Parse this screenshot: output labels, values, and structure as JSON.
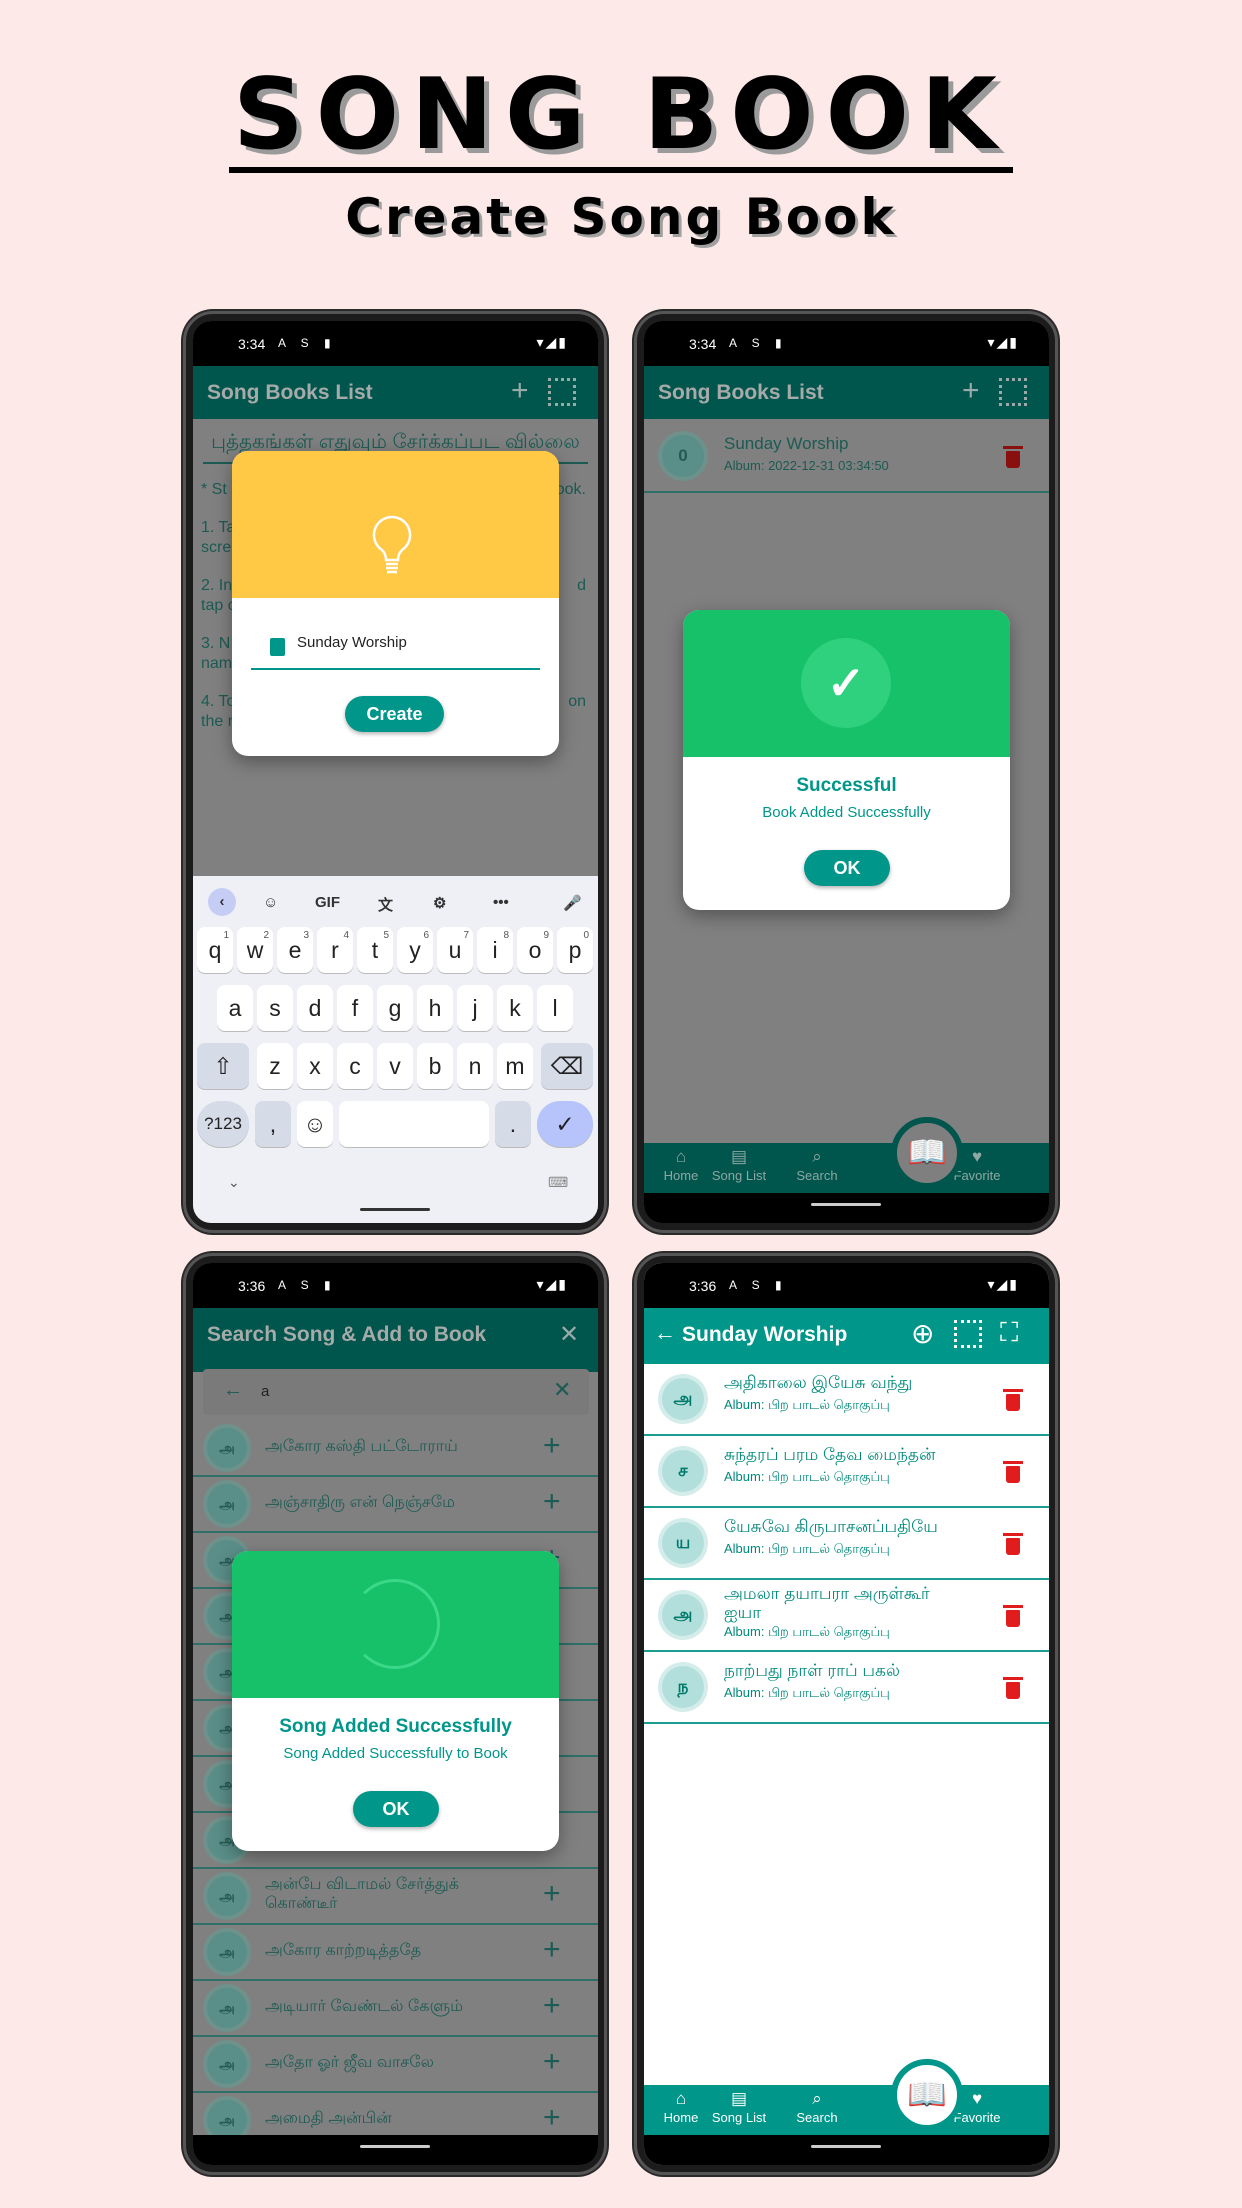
{
  "hero": {
    "title": "SONG BOOK",
    "subtitle": "Create Song Book"
  },
  "status": {
    "time1": "3:34",
    "time2": "3:34",
    "time3": "3:36",
    "time4": "3:36",
    "left_icons": "A S ▮",
    "right_icons": "▾◢▮"
  },
  "colors": {
    "teal": "#00968a",
    "dark_teal": "#00554c",
    "yellow": "#ffc845",
    "green": "#16c16a",
    "delete_red": "#e01c1c",
    "bg": "#fde9e7"
  },
  "screen1": {
    "title": "Song Books List",
    "add_icon": "plus-icon",
    "qr_icon": "qr-search-icon",
    "empty_text": "புத்தகங்கள் எதுவும் சேர்க்கப்பட வில்லை",
    "instructions_left": [
      "*  St",
      "1. Ta",
      "scre",
      "2. In",
      "tap c",
      "3. N",
      "nam",
      "4. To",
      "the r"
    ],
    "instructions_right": [
      "ook.",
      "",
      "",
      "d",
      "",
      "",
      "",
      "on",
      ""
    ],
    "dialog": {
      "icon": "lightbulb-icon",
      "input_value": "Sunday Worship",
      "input_icon": "book-icon",
      "create_label": "Create"
    },
    "keyboard": {
      "toolbar": [
        "‹",
        "☺",
        "GIF",
        "文",
        "⚙",
        "•••",
        "🎤"
      ],
      "row1": [
        "q",
        "w",
        "e",
        "r",
        "t",
        "y",
        "u",
        "i",
        "o",
        "p"
      ],
      "row1_hints": [
        "1",
        "2",
        "3",
        "4",
        "5",
        "6",
        "7",
        "8",
        "9",
        "0"
      ],
      "row2": [
        "a",
        "s",
        "d",
        "f",
        "g",
        "h",
        "j",
        "k",
        "l"
      ],
      "row3": [
        "z",
        "x",
        "c",
        "v",
        "b",
        "n",
        "m"
      ],
      "shift": "⇧",
      "backspace": "⌫",
      "symbols": "?123",
      "comma": ",",
      "emoji": "☺",
      "period": ".",
      "enter": "✓",
      "hide": "⌄",
      "layout": "⌨"
    }
  },
  "screen2": {
    "title": "Song Books List",
    "books": [
      {
        "count": "0",
        "name": "Sunday Worship",
        "album": "Album: 2022-12-31 03:34:50"
      }
    ],
    "dialog": {
      "title": "Successful",
      "message": "Book Added Successfully",
      "ok_label": "OK"
    }
  },
  "bottom_nav": [
    {
      "label": "Home",
      "icon": "⌂"
    },
    {
      "label": "Song List",
      "icon": "▤"
    },
    {
      "label": "Search",
      "icon": "⌕"
    },
    {
      "label": "Favorite",
      "icon": "♥"
    }
  ],
  "fab_icon": "📖",
  "screen3": {
    "title": "Search Song & Add to Book",
    "search_value": "a",
    "songs": [
      {
        "initial": "அ",
        "title": "அகோர கஸ்தி பட்டோராய்"
      },
      {
        "initial": "அ",
        "title": "அஞ்சாதிரு என் நெஞ்சமே"
      },
      {
        "initial": "அ",
        "title": ""
      },
      {
        "initial": "அ",
        "title": ""
      },
      {
        "initial": "அ",
        "title": ""
      },
      {
        "initial": "அ",
        "title": ""
      },
      {
        "initial": "அ",
        "title": ""
      },
      {
        "initial": "அ",
        "title": ""
      },
      {
        "initial": "அ",
        "title": "அன்பே விடாமல் சேர்த்துக் கொண்டீர்"
      },
      {
        "initial": "அ",
        "title": "அகோர காற்றடித்ததே"
      },
      {
        "initial": "அ",
        "title": "அடியார் வேண்டல் கேளும்"
      },
      {
        "initial": "அ",
        "title": "அதோ ஓர் ஜீவ வாசலே"
      },
      {
        "initial": "அ",
        "title": "அமைதி அன்பின்"
      }
    ],
    "dialog": {
      "title": "Song Added Successfully",
      "message": "Song Added Successfully to Book",
      "ok_label": "OK"
    }
  },
  "screen4": {
    "title": "Sunday Worship",
    "songs": [
      {
        "initial": "அ",
        "title": "அதிகாலை இயேசு வந்து",
        "album": "Album: பிற பாடல் தொகுப்பு"
      },
      {
        "initial": "ச",
        "title": "சுந்தரப் பரம தேவ மைந்தன்",
        "album": "Album: பிற பாடல் தொகுப்பு"
      },
      {
        "initial": "ய",
        "title": "யேசுவே கிருபாசனப்பதியே",
        "album": "Album: பிற பாடல் தொகுப்பு"
      },
      {
        "initial": "அ",
        "title": "அமலா தயாபரா அருள்கூர் ஐயா",
        "album": "Album: பிற பாடல் தொகுப்பு"
      },
      {
        "initial": "ந",
        "title": "நாற்பது நாள் ராப் பகல்",
        "album": "Album: பிற பாடல் தொகுப்பு"
      }
    ]
  }
}
